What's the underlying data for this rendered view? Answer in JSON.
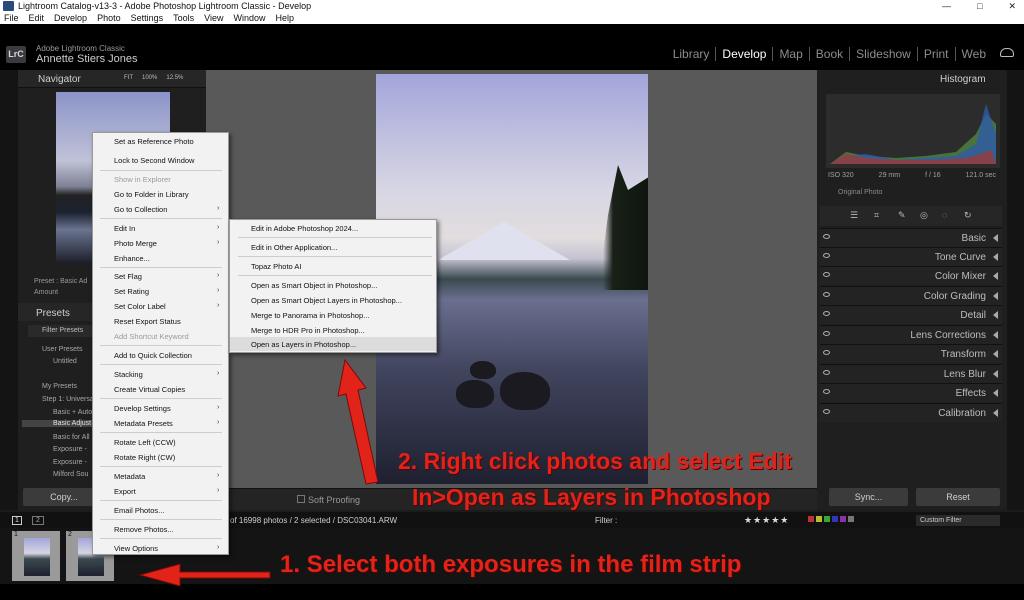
{
  "window": {
    "title": "Lightroom Catalog-v13-3 - Adobe Photoshop Lightroom Classic - Develop",
    "controls": [
      "—",
      "□",
      "✕"
    ]
  },
  "menubar": [
    "File",
    "Edit",
    "Develop",
    "Photo",
    "Settings",
    "Tools",
    "View",
    "Window",
    "Help"
  ],
  "identity": {
    "logo": "LrC",
    "app_name": "Adobe Lightroom Classic",
    "user": "Annette Stiers Jones"
  },
  "modules": {
    "items": [
      "Library",
      "Develop",
      "Map",
      "Book",
      "Slideshow",
      "Print",
      "Web"
    ],
    "active": "Develop"
  },
  "navigator": {
    "title": "Navigator",
    "zooms": [
      "FIT",
      "100%",
      "12.5%"
    ]
  },
  "presets_panel": {
    "preset_label": "Preset :",
    "preset_value": "Basic Ad",
    "amount_label": "Amount",
    "title": "Presets",
    "filter_placeholder": "Filter Presets",
    "items": [
      "User Presets",
      "Untitled",
      "My Presets",
      "Step 1: Universal",
      "Basic + Auto",
      "Basic Adjust",
      "Basic for All",
      "Exposure -",
      "Exposure -",
      "Milford Sou"
    ],
    "highlighted": "Basic Adjust"
  },
  "left_buttons": {
    "copy": "Copy..."
  },
  "toolbar": {
    "soft_proofing": "Soft Proofing"
  },
  "histogram": {
    "title": "Histogram",
    "iso": "ISO 320",
    "focal": "29 mm",
    "aperture": "f / 16",
    "shutter": "121.0 sec",
    "original": "Original Photo"
  },
  "right_sections": [
    "Basic",
    "Tone Curve",
    "Color Mixer",
    "Color Grading",
    "Detail",
    "Lens Corrections",
    "Transform",
    "Lens Blur",
    "Effects",
    "Calibration"
  ],
  "right_buttons": {
    "sync": "Sync...",
    "reset": "Reset"
  },
  "filmbar": {
    "page1": "1",
    "page2": "2",
    "info": "of 16998 photos / 2 selected / DSC03041.ARW",
    "filter_label": "Filter :",
    "stars": "★★★★★",
    "custom_filter": "Custom Filter"
  },
  "filmstrip": {
    "thumbs": [
      "1",
      "2"
    ]
  },
  "context_menu": {
    "items": [
      {
        "label": "Set as Reference Photo",
        "disabled": false
      },
      {
        "label": "Lock to Second Window",
        "disabled": false
      },
      {
        "label": "Show in Explorer",
        "disabled": true
      },
      {
        "label": "Go to Folder in Library",
        "disabled": false
      },
      {
        "label": "Go to Collection",
        "disabled": false,
        "submenu": true
      },
      {
        "label": "Edit In",
        "disabled": false,
        "submenu": true
      },
      {
        "label": "Photo Merge",
        "disabled": false,
        "submenu": true
      },
      {
        "label": "Enhance...",
        "disabled": false
      },
      {
        "label": "Set Flag",
        "disabled": false,
        "submenu": true
      },
      {
        "label": "Set Rating",
        "disabled": false,
        "submenu": true
      },
      {
        "label": "Set Color Label",
        "disabled": false,
        "submenu": true
      },
      {
        "label": "Reset Export Status",
        "disabled": false
      },
      {
        "label": "Add Shortcut Keyword",
        "disabled": true
      },
      {
        "label": "Add to Quick Collection",
        "disabled": false
      },
      {
        "label": "Stacking",
        "disabled": false,
        "submenu": true
      },
      {
        "label": "Create Virtual Copies",
        "disabled": false
      },
      {
        "label": "Develop Settings",
        "disabled": false,
        "submenu": true
      },
      {
        "label": "Metadata Presets",
        "disabled": false,
        "submenu": true
      },
      {
        "label": "Rotate Left (CCW)",
        "disabled": false
      },
      {
        "label": "Rotate Right (CW)",
        "disabled": false
      },
      {
        "label": "Metadata",
        "disabled": false,
        "submenu": true
      },
      {
        "label": "Export",
        "disabled": false,
        "submenu": true
      },
      {
        "label": "Email Photos...",
        "disabled": false
      },
      {
        "label": "Remove Photos...",
        "disabled": false
      },
      {
        "label": "View Options",
        "disabled": false,
        "submenu": true
      }
    ]
  },
  "submenu": {
    "items": [
      "Edit in Adobe Photoshop 2024...",
      "Edit in Other Application...",
      "Topaz Photo AI",
      "Open as Smart Object in Photoshop...",
      "Open as Smart Object Layers in Photoshop...",
      "Merge to Panorama in Photoshop...",
      "Merge to HDR Pro in Photoshop...",
      "Open as Layers in Photoshop..."
    ],
    "highlighted": "Open as Layers in Photoshop..."
  },
  "annotations": {
    "step2_line1": "2. Right click photos and select Edit",
    "step2_line2": "In>Open as Layers in Photoshop",
    "step1": "1. Select both exposures in the film strip",
    "color": "#e2231a"
  }
}
